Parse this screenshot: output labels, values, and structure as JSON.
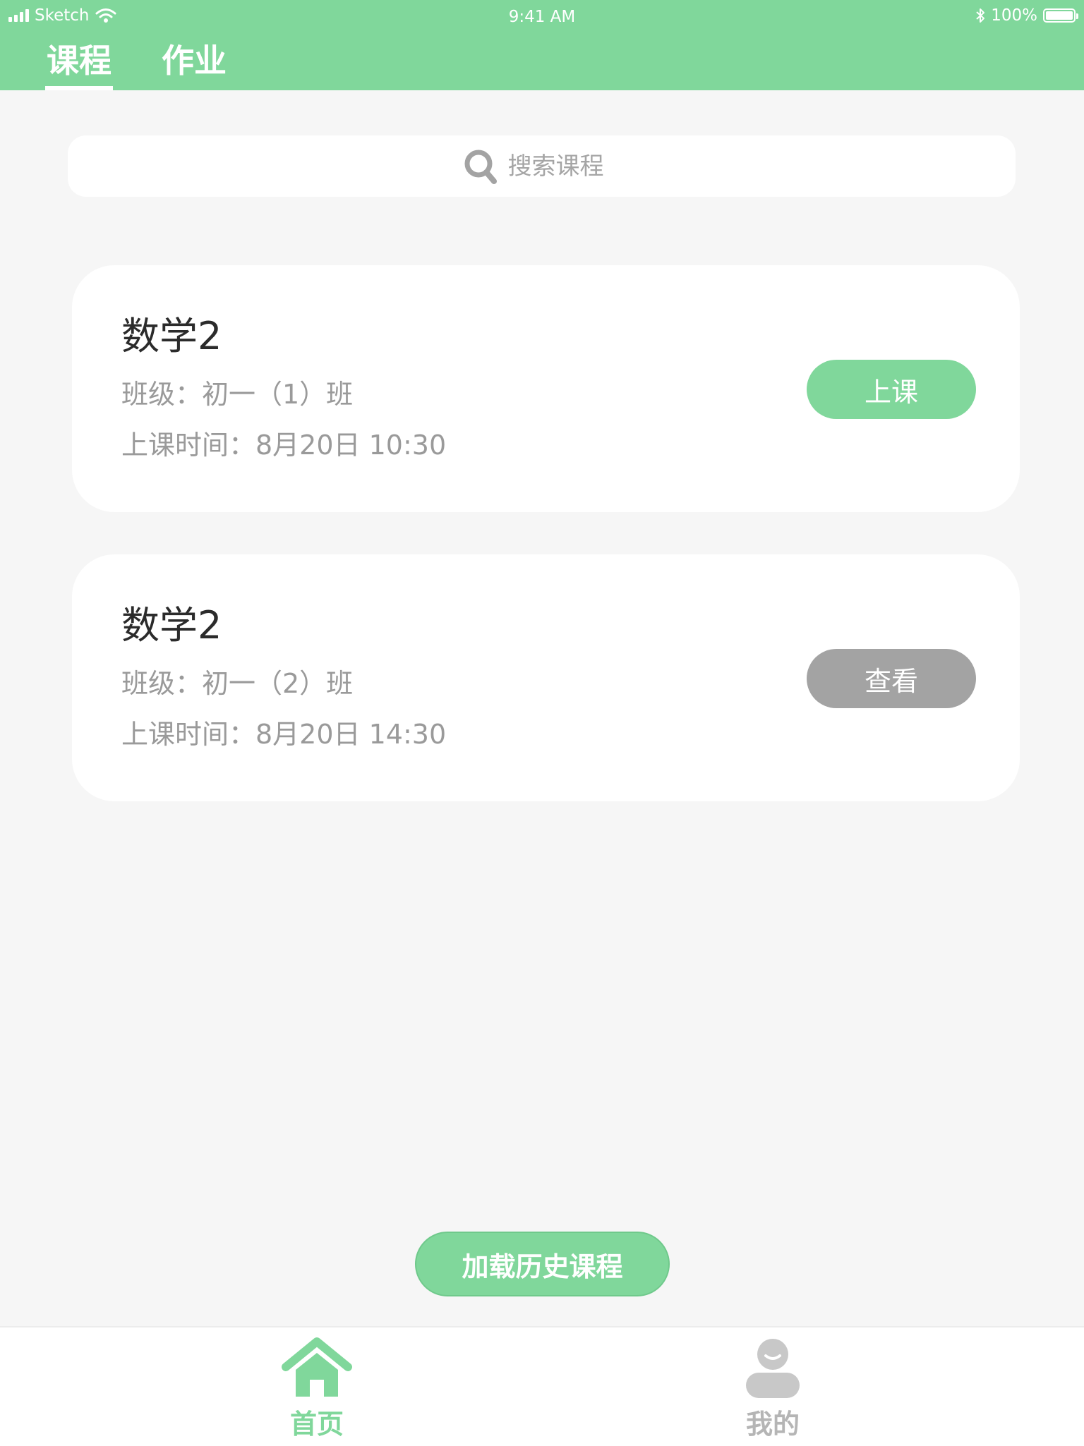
{
  "status_bar": {
    "carrier": "Sketch",
    "time": "9:41 AM",
    "battery": "100%"
  },
  "tabs": [
    {
      "label": "课程",
      "active": true
    },
    {
      "label": "作业",
      "active": false
    }
  ],
  "search": {
    "placeholder": "搜索课程",
    "value": ""
  },
  "courses": [
    {
      "title": "数学2",
      "class": "班级：初一（1）班",
      "time": "上课时间：8月20日 10:30",
      "action_label": "上课",
      "action_color": "#80d79b"
    },
    {
      "title": "数学2",
      "class": "班级：初一（2）班",
      "time": "上课时间：8月20日 14:30",
      "action_label": "查看",
      "action_color": "#a3a3a3"
    }
  ],
  "load_history": {
    "label": "加载历史课程"
  },
  "tab_bar": [
    {
      "label": "首页",
      "icon": "home-icon",
      "active": true
    },
    {
      "label": "我的",
      "icon": "user-icon",
      "active": false
    }
  ],
  "colors": {
    "brand": "#80d79b",
    "background": "#f6f6f6",
    "inactive": "#a3a3a3"
  }
}
